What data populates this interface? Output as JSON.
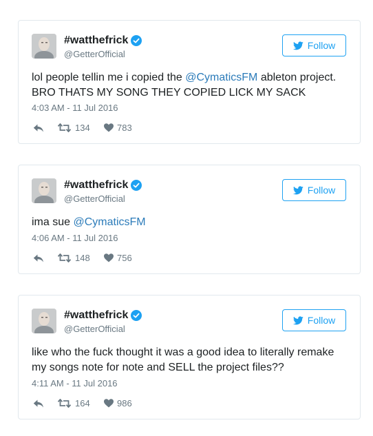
{
  "colors": {
    "accent": "#1da1f2",
    "link": "#2b7bb9",
    "text": "#1c2022",
    "muted": "#697882",
    "border": "#e1e8ed"
  },
  "tweets": [
    {
      "display_name": "#watthefrick",
      "handle": "@GetterOfficial",
      "follow_label": "Follow",
      "text_before": "lol people tellin me i copied the ",
      "mention": "@CymaticsFM",
      "text_after": " ableton project. BRO THATS MY SONG THEY COPIED LICK MY SACK",
      "timestamp": "4:03 AM - 11 Jul 2016",
      "retweets": "134",
      "likes": "783"
    },
    {
      "display_name": "#watthefrick",
      "handle": "@GetterOfficial",
      "follow_label": "Follow",
      "text_before": "ima sue ",
      "mention": "@CymaticsFM",
      "text_after": "",
      "timestamp": "4:06 AM - 11 Jul 2016",
      "retweets": "148",
      "likes": "756"
    },
    {
      "display_name": "#watthefrick",
      "handle": "@GetterOfficial",
      "follow_label": "Follow",
      "text_before": "like who the fuck thought it was a good idea to literally remake my songs note for note and SELL the project files??",
      "mention": "",
      "text_after": "",
      "timestamp": "4:11 AM - 11 Jul 2016",
      "retweets": "164",
      "likes": "986"
    }
  ]
}
